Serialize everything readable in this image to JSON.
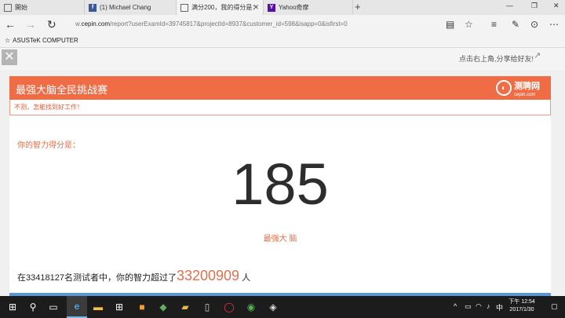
{
  "tabs": [
    {
      "label": "開始",
      "icon": "page-icon"
    },
    {
      "label": "(1) Michael Chang",
      "icon": "facebook-icon"
    },
    {
      "label": "满分200，我的得分是：",
      "icon": "page-icon",
      "active": true
    },
    {
      "label": "Yahoo奇摩",
      "icon": "yahoo-icon"
    }
  ],
  "address": {
    "url_prefix": "w.",
    "url_domain": "cepin.com",
    "url_rest": "/report?userExamId=39745817&projectId=8937&customer_id=598&isapp=0&isfirst=0"
  },
  "favorites": [
    {
      "label": "ASUSTeK COMPUTER",
      "icon": "asus-icon"
    }
  ],
  "page": {
    "share_hint": "点击右上角,分享给好友!",
    "card": {
      "title": "最强大脑全民挑战赛",
      "logo_text": "测聘网",
      "logo_sub": "cepin.com",
      "subtitle": "不测，怎能找到好工作！",
      "score_label": "你的智力得分是：",
      "score": "185",
      "level": "最强大 脑",
      "result_prefix": "在33418127名测试者中，你的智力超过了",
      "result_number": "33200909",
      "result_suffix": "人"
    }
  },
  "taskbar": {
    "time": "下午 12:54",
    "date": "2017/1/30"
  },
  "colors": {
    "accent": "#ef6c45",
    "accent_text": "#e0704e",
    "blue": "#5b95d6"
  }
}
